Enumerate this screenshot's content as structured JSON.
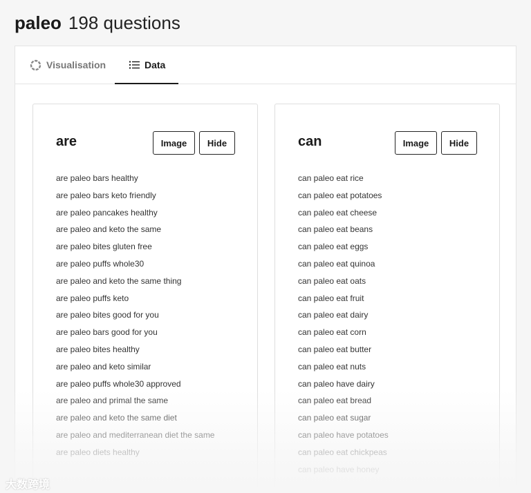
{
  "header": {
    "keyword": "paleo",
    "count_text": "198 questions"
  },
  "tabs": [
    {
      "label": "Visualisation",
      "icon": "ring-loader-icon",
      "active": false
    },
    {
      "label": "Data",
      "icon": "list-icon",
      "active": true
    }
  ],
  "cards": [
    {
      "title": "are",
      "image_label": "Image",
      "hide_label": "Hide",
      "questions": [
        "are paleo bars healthy",
        "are paleo bars keto friendly",
        "are paleo pancakes healthy",
        "are paleo and keto the same",
        "are paleo bites gluten free",
        "are paleo puffs whole30",
        "are paleo and keto the same thing",
        "are paleo puffs keto",
        "are paleo bites good for you",
        "are paleo bars good for you",
        "are paleo bites healthy",
        "are paleo and keto similar",
        "are paleo puffs whole30 approved",
        "are paleo and primal the same",
        "are paleo and keto the same diet",
        "are paleo and mediterranean diet the same",
        "are paleo diets healthy"
      ]
    },
    {
      "title": "can",
      "image_label": "Image",
      "hide_label": "Hide",
      "questions": [
        "can paleo eat rice",
        "can paleo eat potatoes",
        "can paleo eat cheese",
        "can paleo eat beans",
        "can paleo eat eggs",
        "can paleo eat quinoa",
        "can paleo eat oats",
        "can paleo eat fruit",
        "can paleo eat dairy",
        "can paleo eat corn",
        "can paleo eat butter",
        "can paleo eat nuts",
        "can paleo have dairy",
        "can paleo eat bread",
        "can paleo eat sugar",
        "can paleo have potatoes",
        "can paleo eat chickpeas",
        "can paleo have honey"
      ]
    }
  ],
  "watermark": "大数跨境"
}
